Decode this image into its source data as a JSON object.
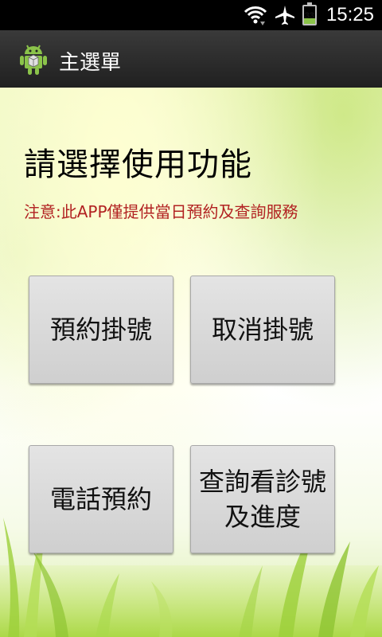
{
  "status_bar": {
    "time": "15:25",
    "battery_level": "33",
    "battery_fill_fraction": 0.33,
    "icons": [
      "wifi-icon",
      "airplane-mode-icon",
      "battery-icon"
    ]
  },
  "action_bar": {
    "title": "主選單",
    "icon": "android-app-icon"
  },
  "main": {
    "heading": "請選擇使用功能",
    "notice": "注意:此APP僅提供當日預約及查詢服務",
    "buttons": [
      {
        "label": "預約掛號"
      },
      {
        "label": "取消掛號"
      },
      {
        "label": "電話預約"
      },
      {
        "label": "查詢看診號及進度"
      }
    ]
  },
  "colors": {
    "notice_text": "#b22222",
    "action_bar": "#2a2a2a",
    "button_face": "#dcdcdc"
  }
}
